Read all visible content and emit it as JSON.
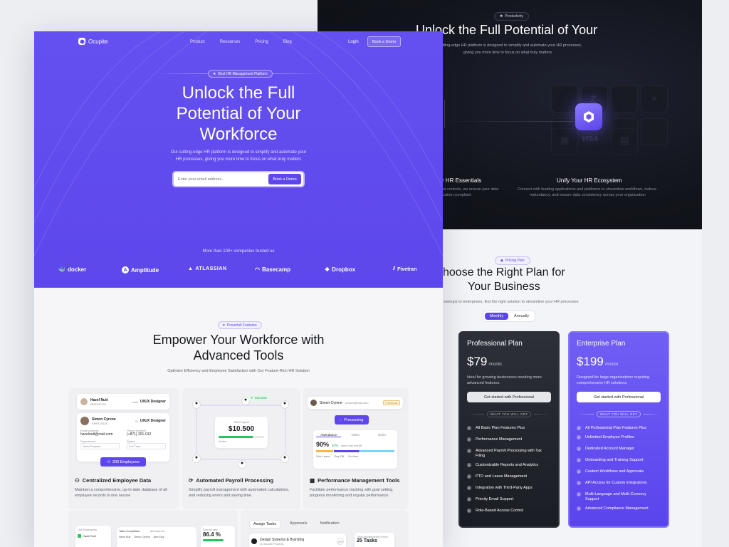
{
  "back": {
    "dark": {
      "badge": "Productivity",
      "title": "Unlock the Full Potential of Your",
      "subtitle_line1": "cutting-edge HR platform is designed to simplify and automate your HR processes,",
      "subtitle_line2": "giving you more time to focus on what truly matters",
      "feat_left_title": "r HR Essentials",
      "feat_left_desc1": "ss controls, we ensure your data",
      "feat_left_desc2": "ization compliant",
      "feat_right_title": "Unify Your HR Ecosystem",
      "feat_right_desc1": "Connect with leading applications and platforms to streamline workflows, reduce",
      "feat_right_desc2": "redundancy, and ensure data consistency across your organization",
      "visa": "VISA"
    },
    "pricing": {
      "badge": "Pricing Plan",
      "title_line1": "hoose the Right Plan for",
      "title_line2": "Your Business",
      "subtitle": "startups to enterprises, find the right solution to streamline your HR processes",
      "toggle_monthly": "Monthly",
      "toggle_annually": "Annually",
      "will_get": "WHAT YOU WILL GET",
      "plans": [
        {
          "name": "Professional Plan",
          "price": "$79",
          "period": "/month",
          "desc": "Ideal for growing businesses needing more advanced features.",
          "cta": "Get started with Professional",
          "features": [
            "All Basic Plan Features Plus",
            "Performance Management",
            "Advanced Payroll Processing with Tax Filing",
            "Customizable Reports and Analytics",
            "PTO and Leave Management",
            "Integration with Third-Party Apps",
            "Priority Email Support",
            "Role-Based Access Control"
          ]
        },
        {
          "name": "Enterprise Plan",
          "price": "$199",
          "period": "/month",
          "desc": "Designed for large organizations requiring comprehensive HR solutions.",
          "cta": "Get started with Professional",
          "features": [
            "All Professional Plan Features Plus",
            "Unlimited Employee Profiles",
            "Dedicated Account Manager",
            "Onboarding and Training Support",
            "Custom Workflows and Approvals",
            "API Access for Custom Integrations",
            "Multi-Language and Multi-Currency Support",
            "Advanced Compliance Management"
          ]
        }
      ]
    }
  },
  "front": {
    "brand": "Ocupite",
    "nav": [
      "Product",
      "Resources",
      "Pricing",
      "Blog"
    ],
    "login": "Login",
    "demo_btn": "Book a Demo",
    "hero": {
      "badge": "Best HR Management Platform",
      "title_line1": "Unlock the Full",
      "title_line2": "Potential of Your",
      "title_line3": "Workforce",
      "subtitle_line1": "Our cutting-edge HR platform is designed to simplify and automate your",
      "subtitle_line2": "HR processes, giving you more time to focus on what truly matters",
      "email_placeholder": "Enter your email address..",
      "cta": "Book a Demo",
      "trusted": "More than 100+ companies trusted us",
      "companies": [
        "docker",
        "Amplitude",
        "ATLASSIAN",
        "Basecamp",
        "Dropbox",
        "Fivetran"
      ]
    },
    "features": {
      "badge": "Powerfull Features",
      "title_line1": "Empower Your Workforce with",
      "title_line2": "Advanced Tools",
      "subtitle": "Optimize Efficiency and Employee Satisfaction with Our Feature-Rich HR Solution",
      "cards": [
        {
          "title": "Centralized Employee Data",
          "desc": "Maintain a comprehensive, up-to-date database of all employee records in one secure"
        },
        {
          "title": "Automated Payroll Processing",
          "desc": "Simplify payroll management with automated calculations, and  reducing errors and saving time."
        },
        {
          "title": "Performance Management Tools",
          "desc": "Facilitate performance tracking with goal setting, progress monitoring and regular performance ."
        }
      ],
      "card1": {
        "emp1_name": "Hazel Nutt",
        "emp1_id": "EMP120124",
        "emp1_role_label": "Lead",
        "emp1_role": "UI/UX Designer",
        "emp2_name": "Simon Cyrene",
        "emp2_id": "EMP120118",
        "emp2_role_label": "Sr",
        "emp2_role": "UI/UX Designer",
        "email_label": "Email Address",
        "email": "hazelnutt@mail.com",
        "phone_label": "Phone Number",
        "phone": "(+871) 201-012",
        "dept_label": "Department",
        "dept": "Team Projects",
        "status_label": "Status",
        "status": "Full Time",
        "count_badge": "200 Employees"
      },
      "card2": {
        "success": "Success",
        "payroll_label": "Total Payroll",
        "payroll_value": "$10.500",
        "status": "Active",
        "progress": 0.75
      },
      "card3": {
        "name": "Simon Cyrene",
        "email": "simonc@mail.com",
        "tag": "Freelance",
        "processing": "Processing",
        "tabs": [
          "Attendance",
          "Tasks",
          "Order"
        ],
        "percent": "90%",
        "delta": "20%",
        "since": "since last month",
        "legend": [
          "Sick Leave",
          "Day Off",
          "On time"
        ]
      },
      "row2": {
        "list_title": "List Employees",
        "list_person": "Hazel Nutt",
        "task_title": "Task Completion",
        "attendance": "Attendance",
        "names": [
          "Hazel Nutt",
          "Simon Cyrene",
          "Alex King"
        ],
        "overall_label": "Overall rate",
        "overall_value": "86.4 %",
        "tabs": [
          "Assign Tasks",
          "Approvals",
          "Notification"
        ],
        "task_name": "Design Systems & Branding",
        "task_project": "in Ocupite Projects",
        "task_pct": "0%",
        "total_label": "Total Assignments Given",
        "total_value": "25 Tasks"
      }
    }
  }
}
